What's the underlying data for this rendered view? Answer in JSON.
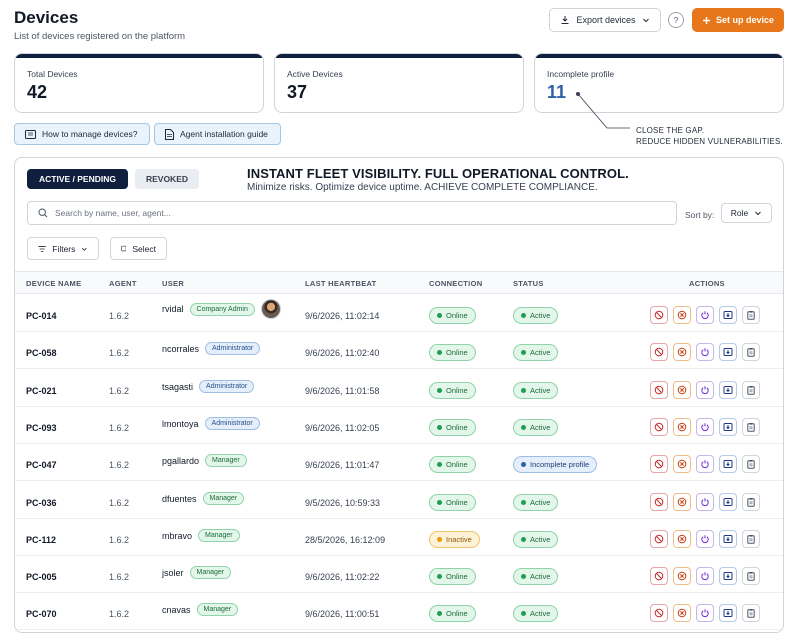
{
  "header": {
    "title": "Devices",
    "subtitle": "List of devices registered on the platform",
    "export_label": "Export devices",
    "help_label": "?",
    "setup_label": "Set up device"
  },
  "stats": [
    {
      "label": "Total Devices",
      "value": "42"
    },
    {
      "label": "Active Devices",
      "value": "37"
    },
    {
      "label": "Incomplete profile",
      "value": "11"
    }
  ],
  "annotation": {
    "line1": "CLOSE THE GAP.",
    "line2": "REDUCE HIDDEN VULNERABILITIES."
  },
  "help_links": {
    "manage": "How to manage devices?",
    "guide": "Agent installation guide"
  },
  "tabs": {
    "active": "ACTIVE / PENDING",
    "revoked": "REVOKED"
  },
  "promo": {
    "title": "INSTANT FLEET VISIBILITY. FULL OPERATIONAL CONTROL.",
    "subtitle": "Minimize risks. Optimize device uptime. ACHIEVE COMPLETE COMPLIANCE."
  },
  "search": {
    "placeholder": "Search by name, user, agent..."
  },
  "sort": {
    "label": "Sort by:",
    "value": "Role"
  },
  "filters": {
    "filters_label": "Filters",
    "select_label": "Select"
  },
  "table": {
    "headers": {
      "device": "DEVICE NAME",
      "agent": "AGENT",
      "user": "USER",
      "heartbeat": "LAST HEARTBEAT",
      "connection": "CONNECTION",
      "status": "STATUS",
      "actions": "ACTIONS"
    },
    "rows": [
      {
        "device": "PC-014",
        "agent": "1.6.2",
        "user": "rvidal",
        "role": "Company Admin",
        "heartbeat": "9/6/2026, 11:02:14",
        "connection": "Online",
        "status": "Active"
      },
      {
        "device": "PC-058",
        "agent": "1.6.2",
        "user": "ncorrales",
        "role": "Administrator",
        "heartbeat": "9/6/2026, 11:02:40",
        "connection": "Online",
        "status": "Active"
      },
      {
        "device": "PC-021",
        "agent": "1.6.2",
        "user": "tsagasti",
        "role": "Administrator",
        "heartbeat": "9/6/2026, 11:01:58",
        "connection": "Online",
        "status": "Active"
      },
      {
        "device": "PC-093",
        "agent": "1.6.2",
        "user": "lmontoya",
        "role": "Administrator",
        "heartbeat": "9/6/2026, 11:02:05",
        "connection": "Online",
        "status": "Active"
      },
      {
        "device": "PC-047",
        "agent": "1.6.2",
        "user": "pgallardo",
        "role": "Manager",
        "heartbeat": "9/6/2026, 11:01:47",
        "connection": "Online",
        "status": "Incomplete profile"
      },
      {
        "device": "PC-036",
        "agent": "1.6.2",
        "user": "dfuentes",
        "role": "Manager",
        "heartbeat": "9/5/2026, 10:59:33",
        "connection": "Online",
        "status": "Active"
      },
      {
        "device": "PC-112",
        "agent": "1.6.2",
        "user": "mbravo",
        "role": "Manager",
        "heartbeat": "28/5/2026, 16:12:09",
        "connection": "Inactive",
        "status": "Active"
      },
      {
        "device": "PC-005",
        "agent": "1.6.2",
        "user": "jsoler",
        "role": "Manager",
        "heartbeat": "9/6/2026, 11:02:22",
        "connection": "Online",
        "status": "Active"
      },
      {
        "device": "PC-070",
        "agent": "1.6.2",
        "user": "cnavas",
        "role": "Manager",
        "heartbeat": "9/6/2026, 11:00:51",
        "connection": "Online",
        "status": "Active"
      }
    ]
  },
  "colors": {
    "accent": "#e8761b",
    "navy": "#0f1f3d",
    "online": "#1f9d55",
    "inactive": "#e39b0b",
    "incomplete": "#2f5fa6"
  },
  "icons": {
    "export": "download-icon",
    "setup": "plus-icon",
    "search": "search-icon",
    "filters": "filter-icon",
    "select": "checkbox-icon",
    "actions": [
      "ban-icon",
      "x-circle-icon",
      "power-icon",
      "import-icon",
      "clipboard-icon"
    ]
  }
}
